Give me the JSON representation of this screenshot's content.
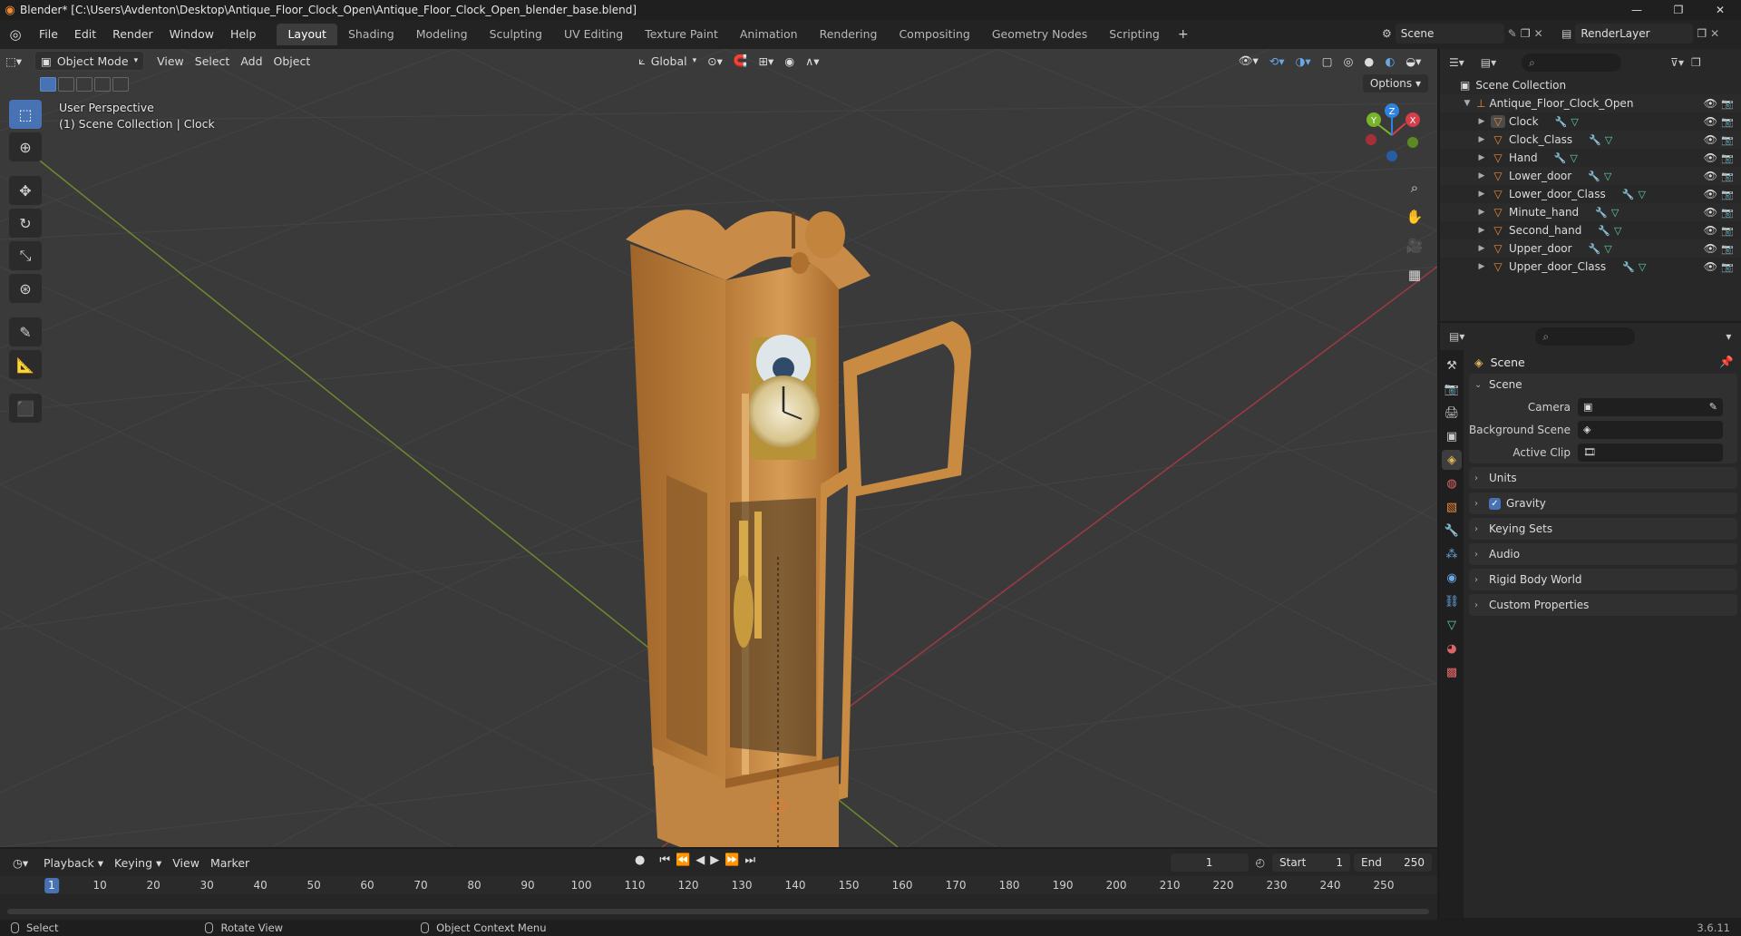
{
  "window": {
    "title": "Blender* [C:\\Users\\Avdenton\\Desktop\\Antique_Floor_Clock_Open\\Antique_Floor_Clock_Open_blender_base.blend]",
    "controls": [
      "—",
      "❐",
      "✕"
    ]
  },
  "menu": {
    "items": [
      "File",
      "Edit",
      "Render",
      "Window",
      "Help"
    ],
    "workspaces": [
      "Layout",
      "Shading",
      "Modeling",
      "Sculpting",
      "UV Editing",
      "Texture Paint",
      "Animation",
      "Rendering",
      "Compositing",
      "Geometry Nodes",
      "Scripting"
    ],
    "active_workspace": "Layout",
    "add_workspace": "+",
    "scene": "Scene",
    "render_layer": "RenderLayer"
  },
  "viewport": {
    "mode": "Object Mode",
    "menus": [
      "View",
      "Select",
      "Add",
      "Object"
    ],
    "transform_orientation": "Global",
    "options": "Options",
    "info_line1": "User Perspective",
    "info_line2": "(1) Scene Collection | Clock",
    "gizmo_axes": [
      "X",
      "Y",
      "Z"
    ]
  },
  "timeline": {
    "menus": [
      "Playback",
      "Keying",
      "View",
      "Marker"
    ],
    "current_frame": "1",
    "start_label": "Start",
    "start": "1",
    "end_label": "End",
    "end": "250",
    "ruler_current": "1",
    "ruler_ticks": [
      "10",
      "20",
      "30",
      "40",
      "50",
      "60",
      "70",
      "80",
      "90",
      "100",
      "110",
      "120",
      "130",
      "140",
      "150",
      "160",
      "170",
      "180",
      "190",
      "200",
      "210",
      "220",
      "230",
      "240",
      "250"
    ]
  },
  "status": {
    "select": "Select",
    "rotate": "Rotate View",
    "context": "Object Context Menu",
    "version": "3.6.11"
  },
  "outliner": {
    "root": "Scene Collection",
    "collection": "Antique_Floor_Clock_Open",
    "objects": [
      "Clock",
      "Clock_Class",
      "Hand",
      "Lower_door",
      "Lower_door_Class",
      "Minute_hand",
      "Second_hand",
      "Upper_door",
      "Upper_door_Class"
    ]
  },
  "properties": {
    "title": "Scene",
    "panel_scene": "Scene",
    "camera_label": "Camera",
    "background_label": "Background Scene",
    "clip_label": "Active Clip",
    "panels": [
      "Units",
      "Gravity",
      "Keying Sets",
      "Audio",
      "Rigid Body World",
      "Custom Properties"
    ],
    "gravity_checked": true
  },
  "colors": {
    "accent": "#4772b3",
    "object_icon": "#e8883a",
    "x_axis": "#d63d4a",
    "y_axis": "#79b32b",
    "z_axis": "#2f83e0"
  }
}
